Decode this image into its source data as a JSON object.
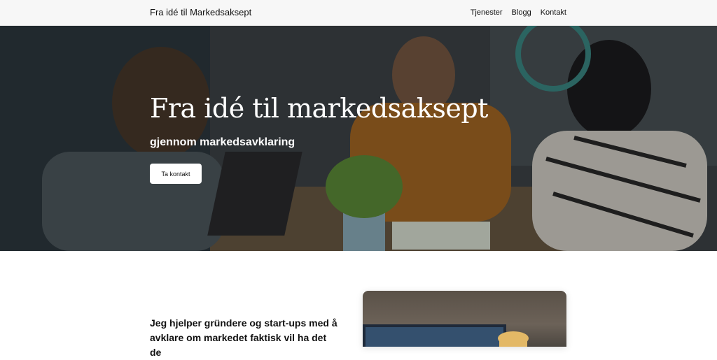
{
  "header": {
    "site_title": "Fra idé til Markedsaksept",
    "nav": [
      "Tjenester",
      "Blogg",
      "Kontakt"
    ]
  },
  "hero": {
    "title": "Fra idé til markedsaksept",
    "subtitle": "gjennom markedsavklaring",
    "cta_label": "Ta kontakt"
  },
  "intro": {
    "text": "Jeg hjelper gründere og start-ups med å avklare om markedet faktisk vil ha det de"
  }
}
